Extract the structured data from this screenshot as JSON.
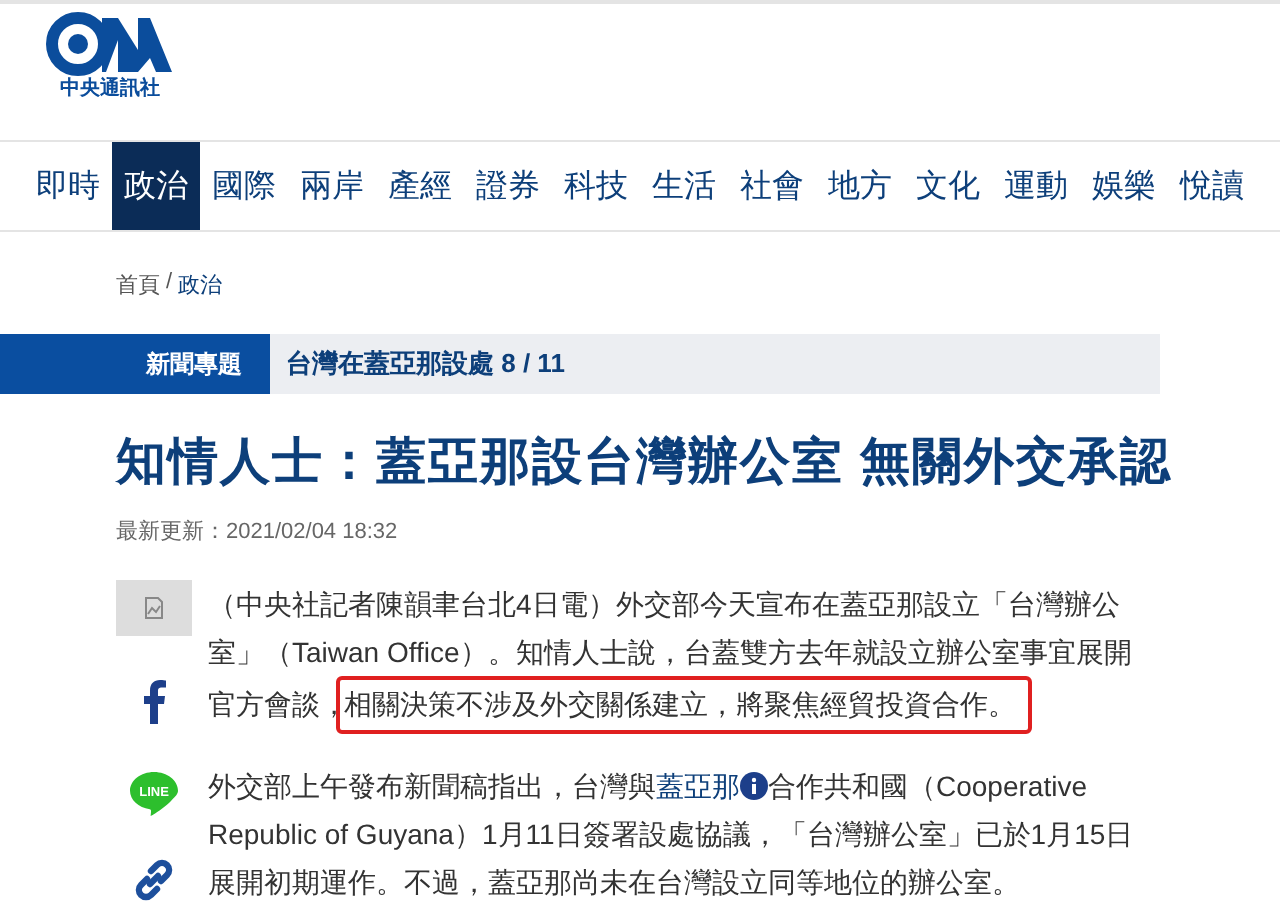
{
  "logo": {
    "caption": "中央通訊社"
  },
  "nav": [
    {
      "label": "即時",
      "selected": false
    },
    {
      "label": "政治",
      "selected": true
    },
    {
      "label": "國際",
      "selected": false
    },
    {
      "label": "兩岸",
      "selected": false
    },
    {
      "label": "產經",
      "selected": false
    },
    {
      "label": "證券",
      "selected": false
    },
    {
      "label": "科技",
      "selected": false
    },
    {
      "label": "生活",
      "selected": false
    },
    {
      "label": "社會",
      "selected": false
    },
    {
      "label": "地方",
      "selected": false
    },
    {
      "label": "文化",
      "selected": false
    },
    {
      "label": "運動",
      "selected": false
    },
    {
      "label": "娛樂",
      "selected": false
    },
    {
      "label": "悅讀",
      "selected": false
    }
  ],
  "breadcrumb": [
    "首頁",
    "/",
    "政治"
  ],
  "topic_bar": {
    "label": "新聞專題",
    "topic": "台灣在蓋亞那設處 8 / 11"
  },
  "headline": "知情人士：蓋亞那設台灣辦公室 無關外交承認",
  "updated": "最新更新：2021/02/04 18:32",
  "share": [
    {
      "kind": "image"
    },
    {
      "kind": "facebook"
    },
    {
      "kind": "line",
      "label": "LINE"
    },
    {
      "kind": "link"
    }
  ],
  "paragraphs": [
    {
      "segments": [
        {
          "kind": "text",
          "text": "（中央社記者陳韻聿台北4日電）外交部今天宣布在蓋亞那設立「台灣辦公室」（Taiwan Office）。知情人士說，台蓋雙方去年就設立辦公室事宜展開官方會談，"
        }
      ],
      "highlighted": "相關決策不涉及外交關係建立，將聚焦經貿投資合作。"
    },
    {
      "segments": [
        {
          "kind": "text",
          "text": "外交部上午發布新聞稿指出，台灣與"
        },
        {
          "kind": "link",
          "text": "蓋亞那"
        },
        {
          "kind": "text",
          "text": "合作共和國（Cooperative Republic of Guyana）1月11日簽署設處協議，「台灣辦公室」已於1月15日展開初期運作。不過，蓋亞那尚未在台灣設立同等地位的辦公室。"
        }
      ]
    }
  ]
}
